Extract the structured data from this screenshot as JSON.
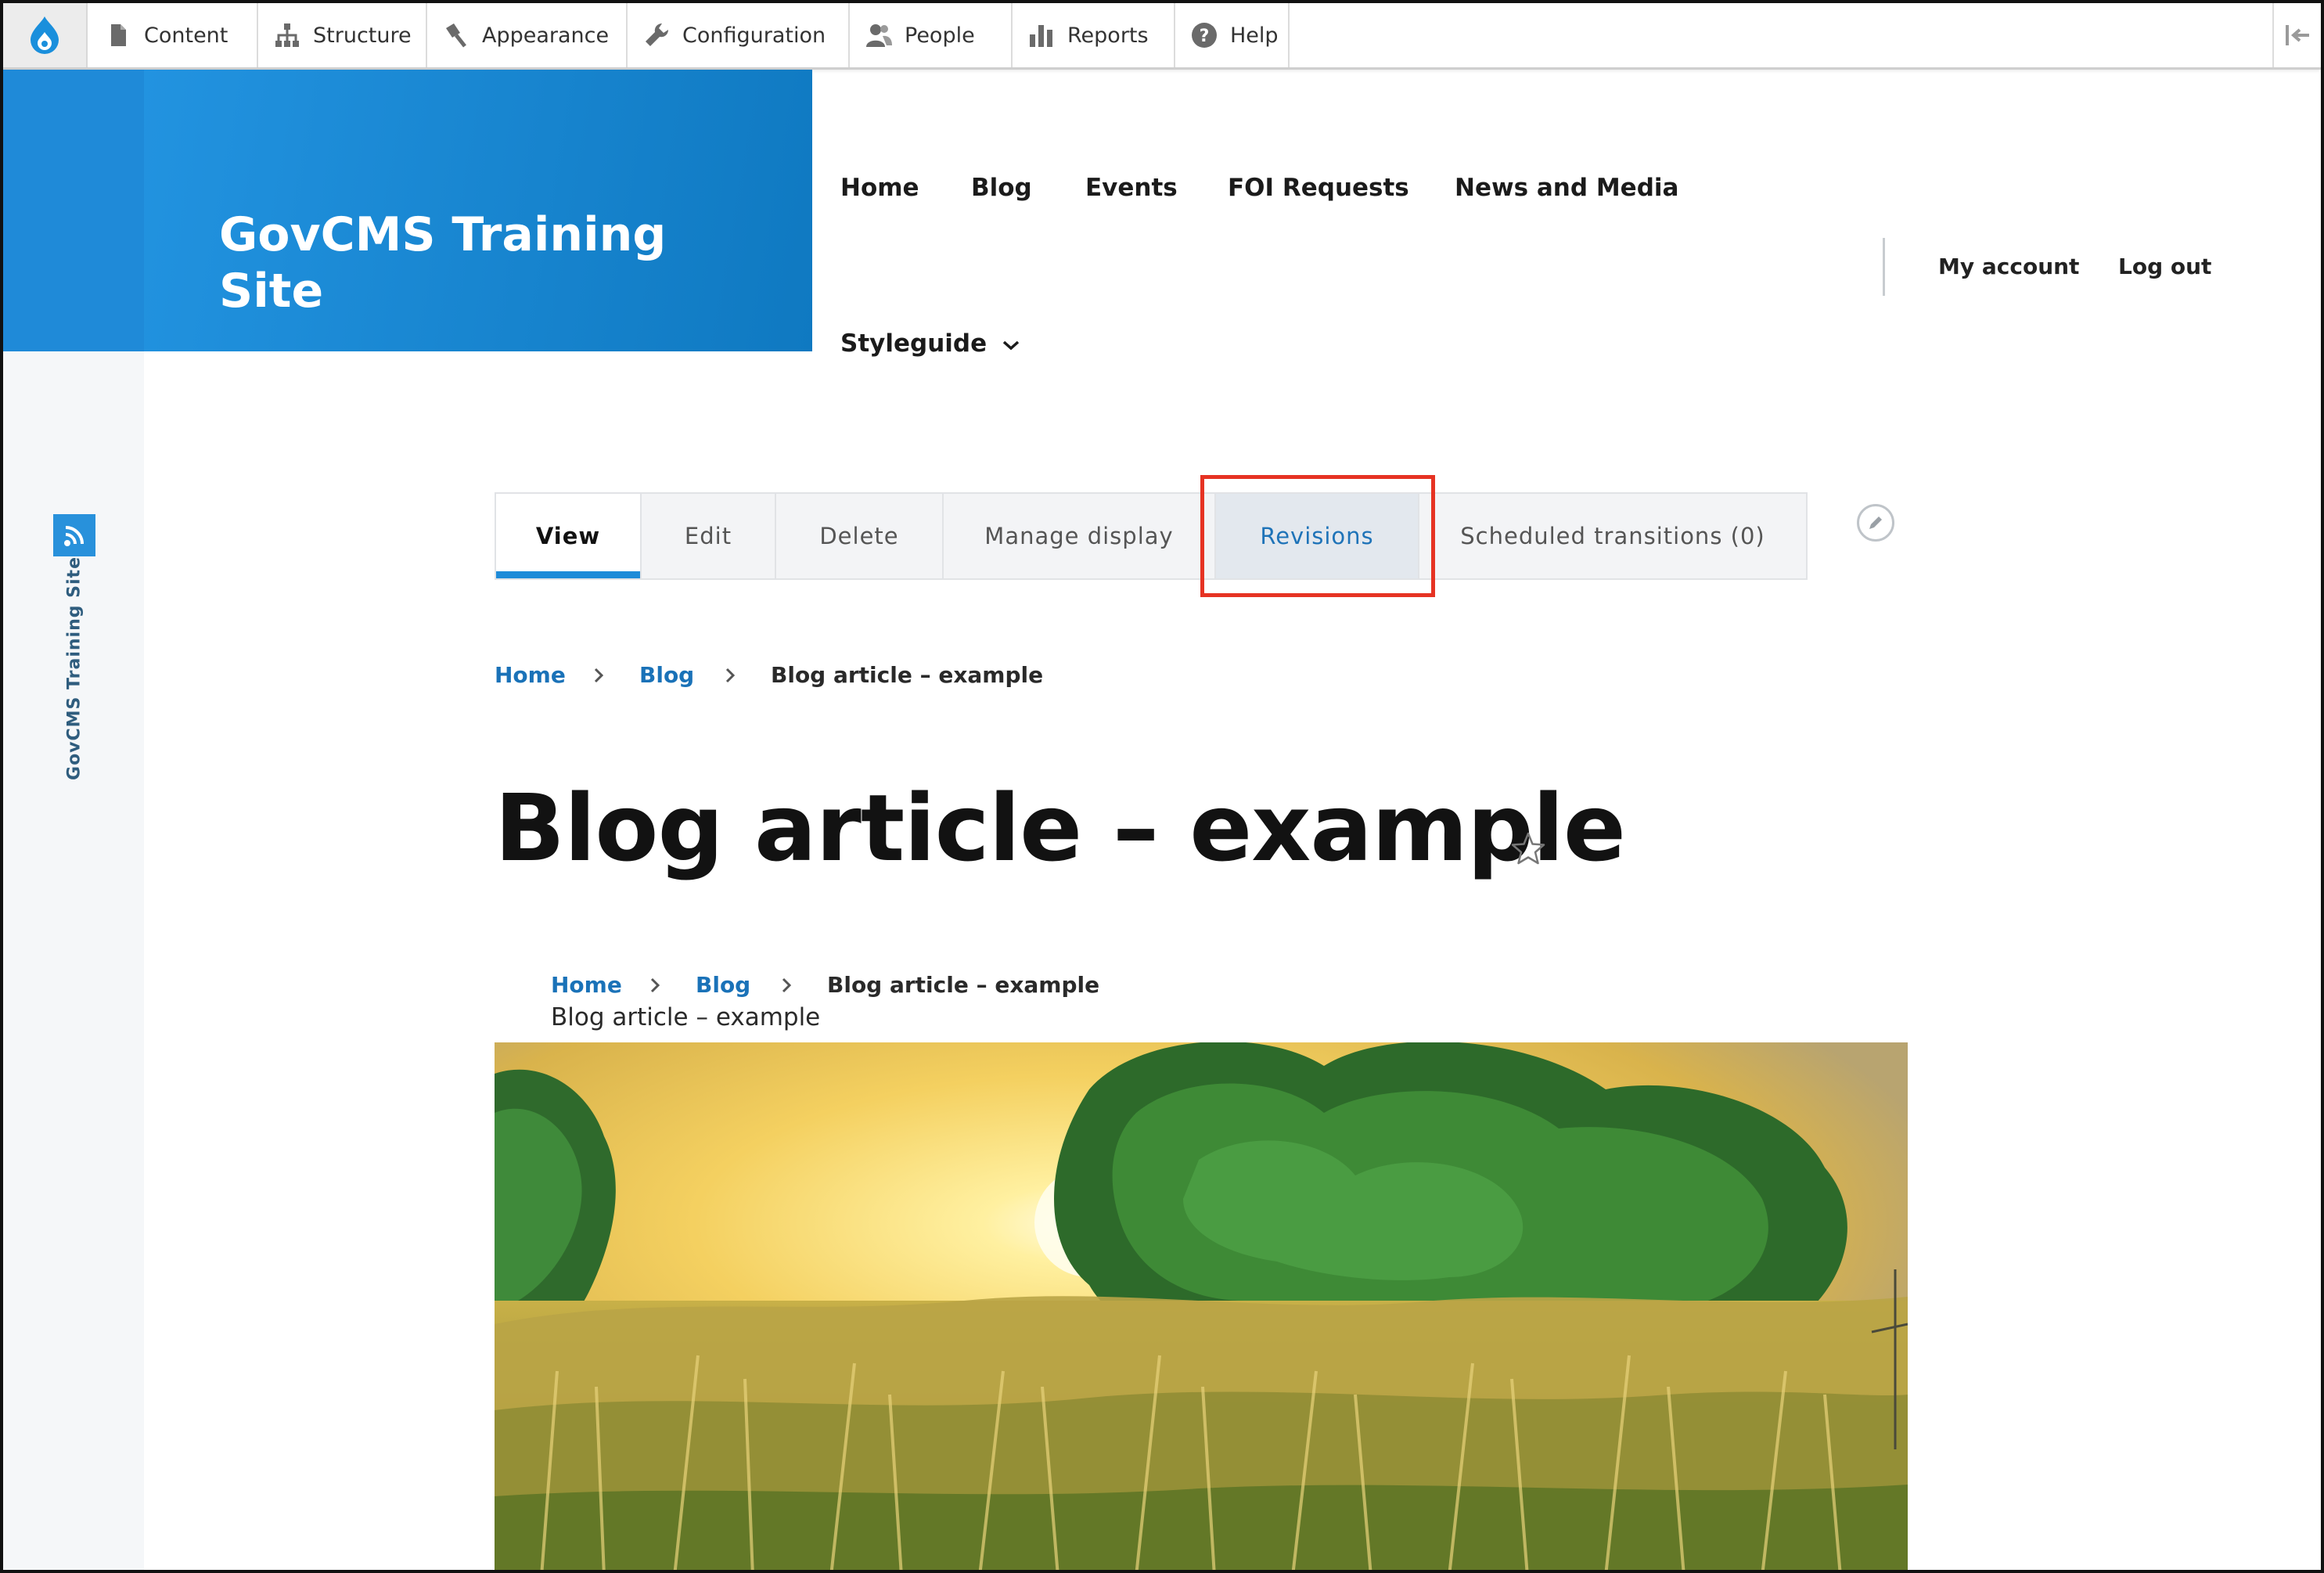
{
  "toolbar": {
    "items": [
      {
        "label": "Content",
        "icon": "file-icon"
      },
      {
        "label": "Structure",
        "icon": "sitemap-icon"
      },
      {
        "label": "Appearance",
        "icon": "paint-icon"
      },
      {
        "label": "Configuration",
        "icon": "wrench-icon"
      },
      {
        "label": "People",
        "icon": "people-icon"
      },
      {
        "label": "Reports",
        "icon": "bar-chart-icon"
      },
      {
        "label": "Help",
        "icon": "help-icon"
      }
    ]
  },
  "sidebar": {
    "label": "GovCMS Training Site",
    "icon": "shortcuts-icon"
  },
  "site": {
    "name": "GovCMS Training Site",
    "brand_color": "#1a85d0"
  },
  "main_nav": {
    "items": [
      "Home",
      "Blog",
      "Events",
      "FOI Requests",
      "News and Media"
    ],
    "dropdown": "Styleguide"
  },
  "account_nav": {
    "my_account": "My account",
    "log_out": "Log out"
  },
  "tabs": {
    "items": [
      {
        "label": "View",
        "state": "active"
      },
      {
        "label": "Edit"
      },
      {
        "label": "Delete"
      },
      {
        "label": "Manage display"
      },
      {
        "label": "Revisions",
        "state": "highlighted"
      },
      {
        "label": "Scheduled transitions (0)"
      }
    ],
    "highlight_color": "#e63323",
    "active_color": "#1e8bd8"
  },
  "breadcrumb": {
    "home": "Home",
    "blog": "Blog",
    "current": "Blog article – example"
  },
  "page": {
    "title": "Blog article – example"
  },
  "body_breadcrumb": {
    "home": "Home",
    "blog": "Blog",
    "current": "Blog article – example"
  },
  "body": {
    "subtitle": "Blog article – example"
  },
  "hero": {
    "description": "frangipani trees in a sunlit grass field at sunset"
  }
}
